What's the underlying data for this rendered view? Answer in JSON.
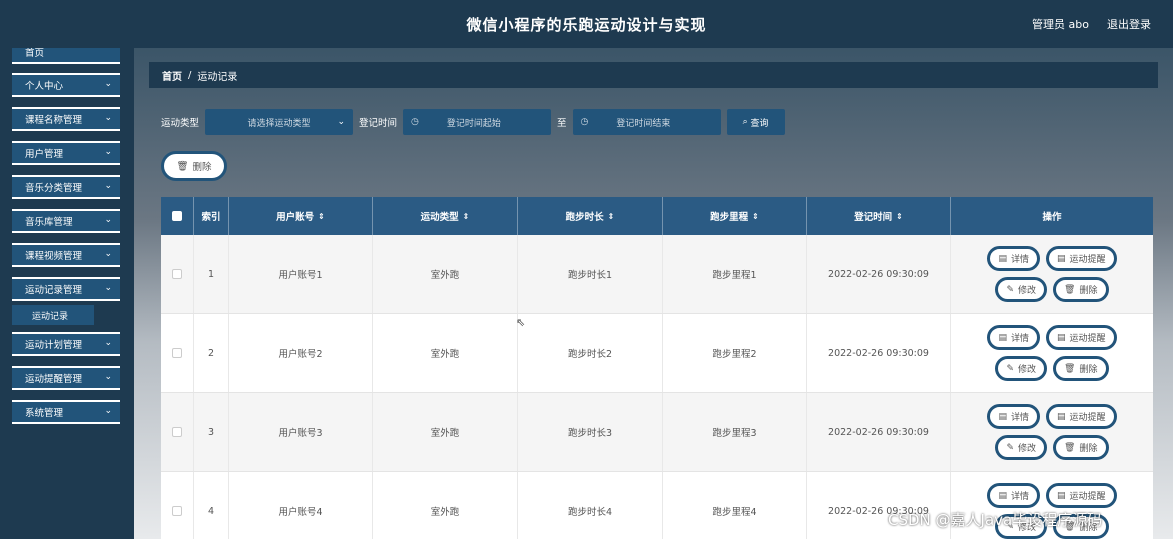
{
  "header": {
    "title": "微信小程序的乐跑运动设计与实现",
    "user": "管理员 abo",
    "logout": "退出登录"
  },
  "sidebar": {
    "home": "首页",
    "items": [
      {
        "label": "个人中心",
        "icon": "chevron-down-icon"
      },
      {
        "label": "课程名称管理",
        "icon": "chevron-down-icon"
      },
      {
        "label": "用户管理",
        "icon": "chevron-down-icon"
      },
      {
        "label": "音乐分类管理",
        "icon": "chevron-down-icon"
      },
      {
        "label": "音乐库管理",
        "icon": "chevron-down-icon"
      },
      {
        "label": "课程视频管理",
        "icon": "chevron-down-icon"
      },
      {
        "label": "运动记录管理",
        "icon": "chevron-down-icon"
      },
      {
        "label": "运动计划管理",
        "icon": "chevron-down-icon"
      },
      {
        "label": "运动提醒管理",
        "icon": "chevron-down-icon"
      },
      {
        "label": "系统管理",
        "icon": "chevron-down-icon"
      }
    ],
    "submenu": "运动记录"
  },
  "breadcrumb": {
    "home": "首页",
    "sep": "/",
    "current": "运动记录"
  },
  "search": {
    "type_label": "运动类型",
    "type_placeholder": "请选择运动类型",
    "time_label": "登记时间",
    "start_placeholder": "登记时间起始",
    "to": "至",
    "end_placeholder": "登记时间结束",
    "query": "查询"
  },
  "actions": {
    "delete": "删除"
  },
  "table": {
    "headers": [
      "索引",
      "用户账号",
      "运动类型",
      "跑步时长",
      "跑步里程",
      "登记时间",
      "操作"
    ],
    "rows": [
      {
        "index": "1",
        "account": "用户账号1",
        "type": "室外跑",
        "duration": "跑步时长1",
        "distance": "跑步里程1",
        "time": "2022-02-26 09:30:09"
      },
      {
        "index": "2",
        "account": "用户账号2",
        "type": "室外跑",
        "duration": "跑步时长2",
        "distance": "跑步里程2",
        "time": "2022-02-26 09:30:09"
      },
      {
        "index": "3",
        "account": "用户账号3",
        "type": "室外跑",
        "duration": "跑步时长3",
        "distance": "跑步里程3",
        "time": "2022-02-26 09:30:09"
      },
      {
        "index": "4",
        "account": "用户账号4",
        "type": "室外跑",
        "duration": "跑步时长4",
        "distance": "跑步里程4",
        "time": "2022-02-26 09:30:09"
      }
    ],
    "ops": {
      "detail": "详情",
      "remind": "运动提醒",
      "edit": "修改",
      "delete": "删除"
    }
  },
  "watermark": "CSDN @嘉人Java毕设程序源码",
  "colors": {
    "primary": "#22547a",
    "header": "#1e3a50",
    "table_head": "#2b5b84"
  }
}
